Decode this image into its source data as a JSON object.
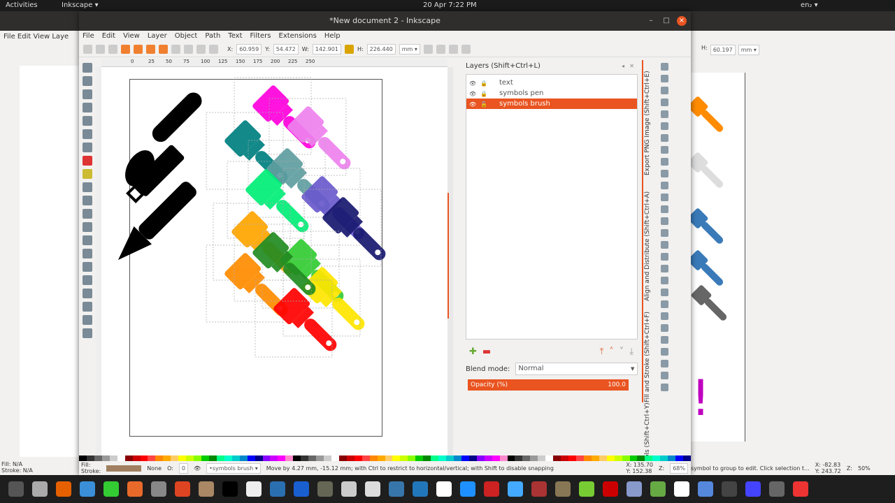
{
  "topbar": {
    "activities": "Activities",
    "app": "Inkscape ▾",
    "clock": "20 Apr  7:22 PM",
    "lang": "en₂ ▾"
  },
  "window": {
    "title": "*New document 2 - Inkscape",
    "minimize": "–",
    "maximize": "□",
    "close": "×"
  },
  "menu": [
    "File",
    "Edit",
    "View",
    "Layer",
    "Object",
    "Path",
    "Text",
    "Filters",
    "Extensions",
    "Help"
  ],
  "toolbar": {
    "x_label": "X:",
    "x": "60.959",
    "y_label": "Y:",
    "y": "54.472",
    "w_label": "W:",
    "w": "142.901",
    "h_label": "H:",
    "h": "226.440",
    "unit": "mm ▾"
  },
  "ruler": [
    "0",
    "25",
    "50",
    "75",
    "100",
    "125",
    "150",
    "175",
    "200",
    "225",
    "250"
  ],
  "layers_panel": {
    "title": "Layers (Shift+Ctrl+L)",
    "layers": [
      {
        "name": "text",
        "selected": false
      },
      {
        "name": "symbols pen",
        "selected": false
      },
      {
        "name": "symbols brush",
        "selected": true
      }
    ],
    "blend_label": "Blend mode:",
    "blend_value": "Normal",
    "opacity_label": "Opacity (%)",
    "opacity_value": "100.0"
  },
  "dock_tabs": [
    "Export PNG Image (Shift+Ctrl+E)",
    "Align and Distribute (Shift+Ctrl+A)",
    "Fill and Stroke (Shift+Ctrl+F)",
    "ols (Shift+Ctrl+Y)"
  ],
  "status": {
    "fill_label": "Fill:",
    "stroke_label": "Stroke:",
    "stroke_value": "None",
    "opacity_label": "O:",
    "opacity": "0",
    "layer": "•symbols brush ▾",
    "message": "Move by 4.27 mm, -15.12 mm; with Ctrl to restrict to horizontal/vertical; with Shift to disable snapping",
    "cx": "X: 135.70",
    "cy": "Y: 152.38",
    "zoom_label": "Z:",
    "zoom": "68%"
  },
  "bg_left": {
    "menu": "File  Edit  View  Laye",
    "fill": "Fill:",
    "fill_v": "N/A",
    "stroke": "Stroke:",
    "stroke_v": "N/A"
  },
  "bg_right": {
    "h": "60.197",
    "unit": "mm ▾",
    "status": "symbol to group to edit. Click selection t...",
    "x": "-82.83",
    "y": "243.72",
    "zoom": "50%"
  },
  "brush_colors": [
    "#ff00dd",
    "#ee82ee",
    "#008080",
    "#5f9ea0",
    "#00ee77",
    "#6a5acd",
    "#ffa500",
    "#191970",
    "#ff8c00",
    "#32cd32",
    "#ffe600",
    "#ff0000",
    "#228b22"
  ],
  "accent": "#e95420"
}
